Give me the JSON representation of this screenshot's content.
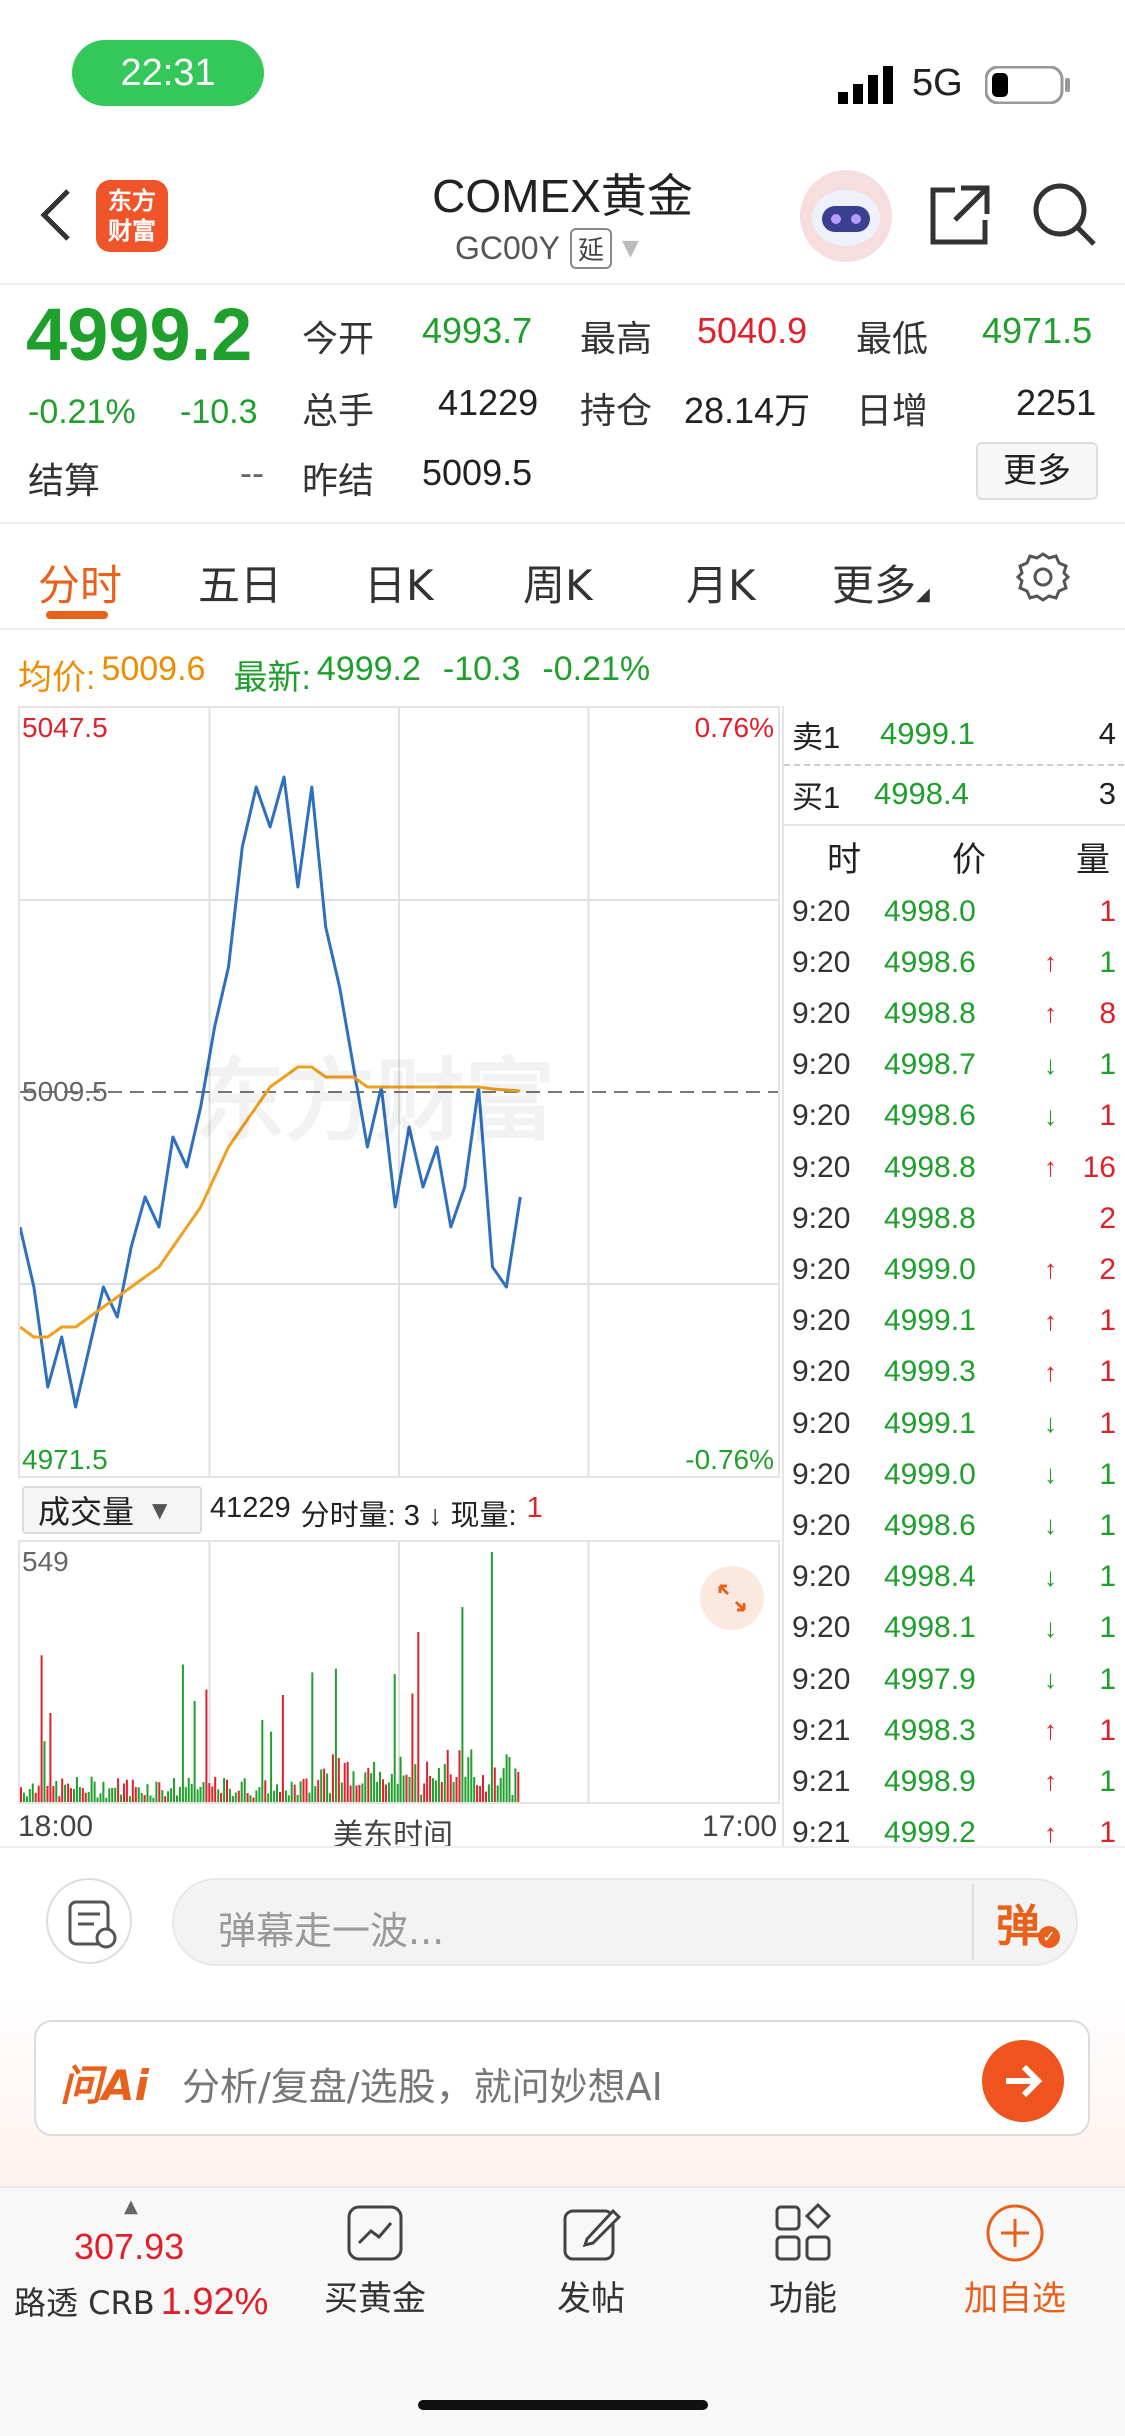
{
  "status_bar": {
    "time": "22:31",
    "network": "5G"
  },
  "header": {
    "brand_line1": "东方",
    "brand_line2": "财富",
    "title": "COMEX黄金",
    "code": "GC00Y",
    "code_tag": "延"
  },
  "quote": {
    "price": "4999.2",
    "change_pct": "-0.21%",
    "change": "-10.3",
    "settle_label": "结算",
    "settle_value": "--",
    "open_label": "今开",
    "open_value": "4993.7",
    "high_label": "最高",
    "high_value": "5040.9",
    "low_label": "最低",
    "low_value": "4971.5",
    "volume_label": "总手",
    "volume_value": "41229",
    "oi_label": "持仓",
    "oi_value": "28.14万",
    "daily_inc_label": "日增",
    "daily_inc_value": "2251",
    "prev_settle_label": "昨结",
    "prev_settle_value": "5009.5",
    "more_button": "更多"
  },
  "tabs": [
    "分时",
    "五日",
    "日K",
    "周K",
    "月K",
    "更多"
  ],
  "info_line": {
    "avg_label": "均价:",
    "avg_value": "5009.6",
    "latest_label": "最新:",
    "latest_value": "4999.2",
    "latest_change": "-10.3",
    "latest_pct": "-0.21%"
  },
  "chart_labels": {
    "top_price": "5047.5",
    "top_pct": "0.76%",
    "mid_price": "5009.5",
    "bottom_price": "4971.5",
    "bottom_pct": "-0.76%",
    "volume_select": "成交量",
    "volume_info_total": "41229",
    "volume_info_rest": "分时量: 3 ↓ 现量:",
    "volume_info_now": "1",
    "vol_max": "549",
    "x_start": "18:00",
    "x_mid": "美东时间",
    "x_end": "17:00",
    "watermark": "东方财富"
  },
  "chart_data": {
    "type": "line",
    "x_range": [
      "18:00",
      "17:00"
    ],
    "ylim": [
      4971.5,
      5047.5
    ],
    "reference_line": 5009.5,
    "series": [
      {
        "name": "最新",
        "values": [
          4996,
          4990,
          4980,
          4985,
          4978,
          4984,
          4990,
          4987,
          4994,
          4999,
          4996,
          5005,
          5002,
          5008,
          5016,
          5022,
          5034,
          5040,
          5036,
          5041,
          5030,
          5040,
          5026,
          5020,
          5012,
          5004,
          5010,
          4998,
          5006,
          5000,
          5004,
          4996,
          5000,
          5010,
          4992,
          4990,
          4999
        ]
      },
      {
        "name": "均价",
        "values": [
          4986,
          4985,
          4985,
          4986,
          4986,
          4987,
          4988,
          4989,
          4990,
          4991,
          4992,
          4994,
          4996,
          4998,
          5001,
          5004,
          5006,
          5008,
          5010,
          5011,
          5012,
          5012,
          5011,
          5011,
          5011,
          5010,
          5010,
          5010,
          5010,
          5010,
          5010,
          5010,
          5010,
          5010,
          5009.8,
          5009.7,
          5009.6
        ]
      }
    ],
    "volume_max": 549
  },
  "order_book": {
    "ask_label": "卖1",
    "ask_price": "4999.1",
    "ask_vol": "4",
    "bid_label": "买1",
    "bid_price": "4998.4",
    "bid_vol": "3",
    "col_time": "时",
    "col_price": "价",
    "col_vol": "量"
  },
  "trades": [
    {
      "time": "9:20",
      "price": "4998.0",
      "arrow": "",
      "vol": "1",
      "vol_color": "#e0202a"
    },
    {
      "time": "9:20",
      "price": "4998.6",
      "arrow": "↑",
      "vol": "1",
      "vol_color": "#1f9f2c"
    },
    {
      "time": "9:20",
      "price": "4998.8",
      "arrow": "↑",
      "vol": "8",
      "vol_color": "#e0202a"
    },
    {
      "time": "9:20",
      "price": "4998.7",
      "arrow": "↓",
      "vol": "1",
      "vol_color": "#1f9f2c"
    },
    {
      "time": "9:20",
      "price": "4998.6",
      "arrow": "↓",
      "vol": "1",
      "vol_color": "#e0202a"
    },
    {
      "time": "9:20",
      "price": "4998.8",
      "arrow": "↑",
      "vol": "16",
      "vol_color": "#e0202a"
    },
    {
      "time": "9:20",
      "price": "4998.8",
      "arrow": "",
      "vol": "2",
      "vol_color": "#e0202a"
    },
    {
      "time": "9:20",
      "price": "4999.0",
      "arrow": "↑",
      "vol": "2",
      "vol_color": "#e0202a"
    },
    {
      "time": "9:20",
      "price": "4999.1",
      "arrow": "↑",
      "vol": "1",
      "vol_color": "#e0202a"
    },
    {
      "time": "9:20",
      "price": "4999.3",
      "arrow": "↑",
      "vol": "1",
      "vol_color": "#e0202a"
    },
    {
      "time": "9:20",
      "price": "4999.1",
      "arrow": "↓",
      "vol": "1",
      "vol_color": "#e0202a"
    },
    {
      "time": "9:20",
      "price": "4999.0",
      "arrow": "↓",
      "vol": "1",
      "vol_color": "#1f9f2c"
    },
    {
      "time": "9:20",
      "price": "4998.6",
      "arrow": "↓",
      "vol": "1",
      "vol_color": "#1f9f2c"
    },
    {
      "time": "9:20",
      "price": "4998.4",
      "arrow": "↓",
      "vol": "1",
      "vol_color": "#1f9f2c"
    },
    {
      "time": "9:20",
      "price": "4998.1",
      "arrow": "↓",
      "vol": "1",
      "vol_color": "#1f9f2c"
    },
    {
      "time": "9:20",
      "price": "4997.9",
      "arrow": "↓",
      "vol": "1",
      "vol_color": "#1f9f2c"
    },
    {
      "time": "9:21",
      "price": "4998.3",
      "arrow": "↑",
      "vol": "1",
      "vol_color": "#e0202a"
    },
    {
      "time": "9:21",
      "price": "4998.9",
      "arrow": "↑",
      "vol": "1",
      "vol_color": "#1f9f2c"
    },
    {
      "time": "9:21",
      "price": "4999.2",
      "arrow": "↑",
      "vol": "1",
      "vol_color": "#e0202a"
    }
  ],
  "comment_bar": {
    "placeholder": "弹幕走一波...",
    "danmu_button": "弹"
  },
  "ai_bar": {
    "logo": "问Ai",
    "placeholder": "分析/复盘/选股，就问妙想AI"
  },
  "bottom_nav": {
    "index_value": "307.93",
    "index_name": "路透 CRB",
    "index_pct": "1.92%",
    "buy_gold": "买黄金",
    "post": "发帖",
    "functions": "功能",
    "add_watch": "加自选"
  },
  "colors": {
    "up": "#e0202a",
    "down": "#1f9f2c",
    "accent": "#e8601a",
    "price_line": "#2f6fbf",
    "avg_line": "#f0a020"
  }
}
